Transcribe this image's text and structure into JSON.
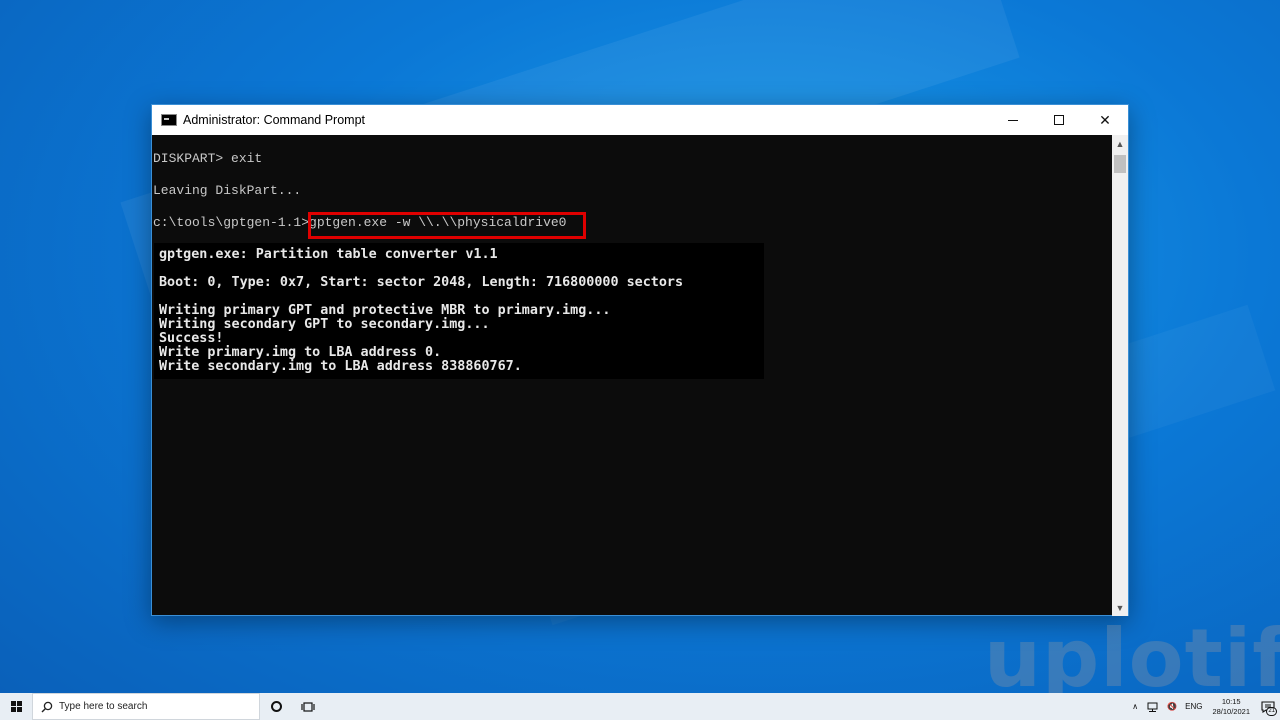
{
  "window": {
    "title": "Administrator: Command Prompt",
    "minimize_symbol": "—",
    "close_symbol": "✕"
  },
  "console": {
    "lines": [
      "DISKPART> exit",
      "Leaving DiskPart...",
      "c:\\tools\\gptgen-1.1>gptgen.exe -w \\\\.\\\\physicaldrive0"
    ],
    "highlighted_command": "gptgen.exe -w \\\\.\\\\physicaldrive0",
    "highlight_color": "#e00000",
    "output": [
      "gptgen.exe: Partition table converter v1.1",
      "Boot: 0, Type: 0x7, Start: sector 2048, Length: 716800000 sectors",
      "Writing primary GPT and protective MBR to primary.img...",
      "Writing secondary GPT to secondary.img...",
      "Success!",
      "Write primary.img to LBA address 0.",
      "Write secondary.img to LBA address 838860767."
    ]
  },
  "watermark": "uplotify",
  "taskbar": {
    "search_placeholder": "Type here to search",
    "language": "ENG",
    "time": "10:15",
    "date": "28/10/2021",
    "notification_count": "21"
  },
  "icons": [
    "windows-start-icon",
    "search-icon",
    "cortana-icon",
    "task-view-icon",
    "chevron-up-icon",
    "network-icon",
    "volume-icon",
    "notification-icon",
    "cmd-app-icon"
  ]
}
